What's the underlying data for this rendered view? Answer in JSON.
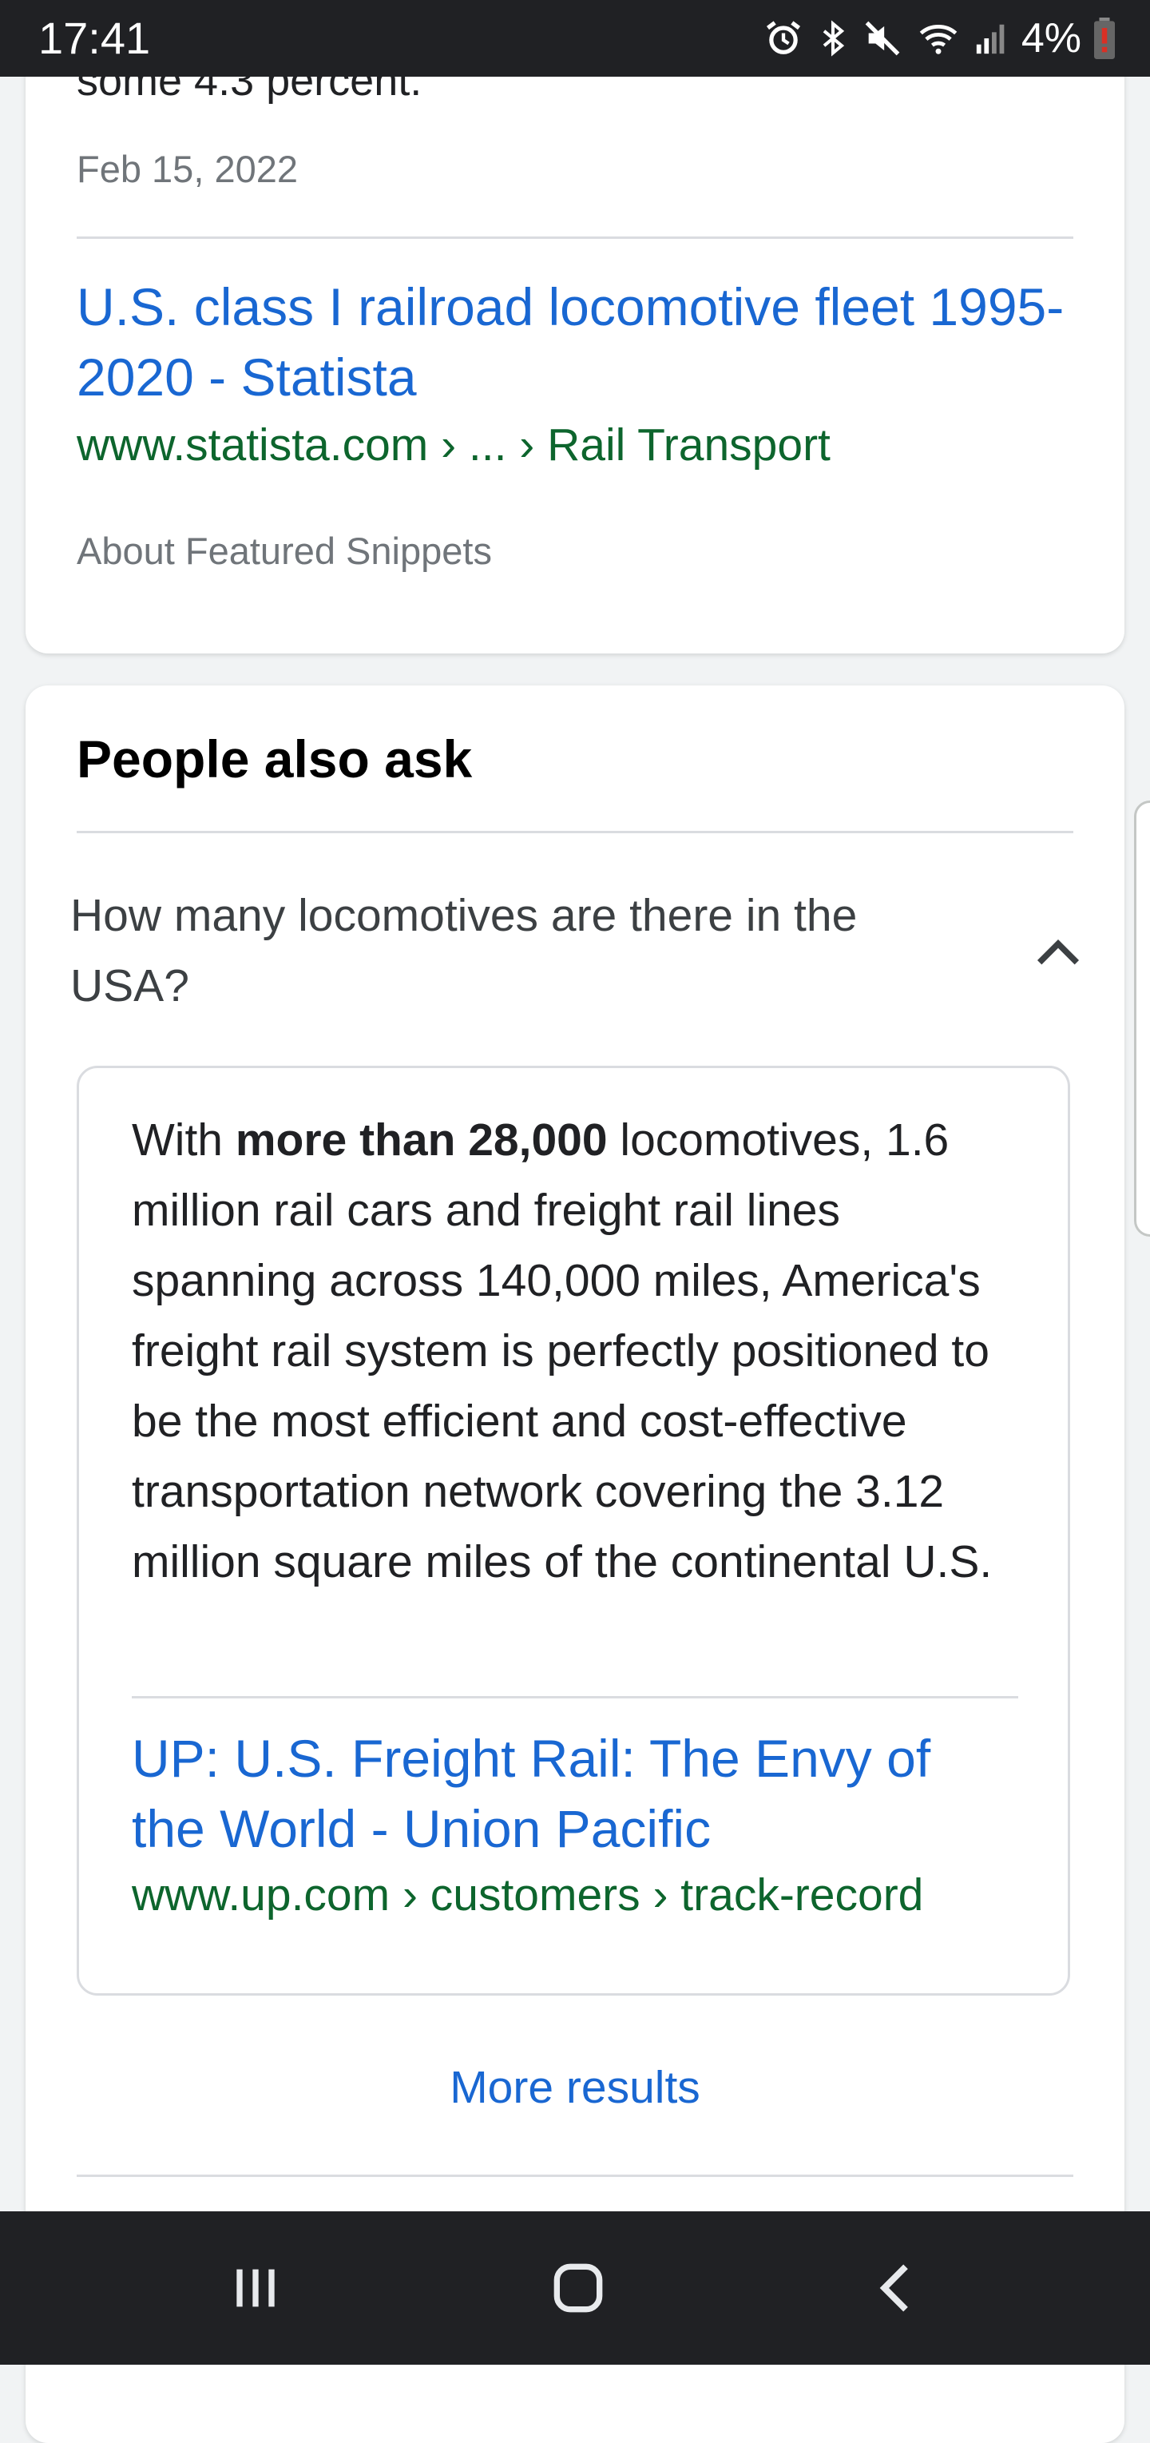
{
  "status_bar": {
    "time": "17:41",
    "battery": "4%",
    "icons": [
      "alarm-icon",
      "bluetooth-icon",
      "mute-icon",
      "wifi-icon",
      "signal-icon",
      "battery-low-icon"
    ]
  },
  "snippet": {
    "text_tail": "some 4.3 percent.",
    "date": "Feb 15, 2022",
    "source_title": "U.S. class I railroad locomotive fleet 1995-2020 - Statista",
    "source_url": "www.statista.com › ... › Rail Transport",
    "about": "About Featured Snippets"
  },
  "people_also_ask": {
    "title": "People also ask",
    "question": "How many locomotives are there in the USA?",
    "answer": {
      "lead": "With ",
      "bold": "more than 28,000",
      "rest": " locomotives, 1.6 million rail cars and freight rail lines spanning across 140,000 miles, America's freight rail system is perfectly positioned to be the most efficient and cost-effective transportation network covering the 3.12 million square miles of the continental U.S."
    },
    "source_title": "UP: U.S. Freight Rail: The Envy of the World - Union Pacific",
    "source_url": "www.up.com › customers › track-record",
    "more_results": "More results"
  },
  "nav_bar": {
    "buttons": [
      "recent-apps-icon",
      "home-icon",
      "back-icon"
    ]
  },
  "colors": {
    "link": "#1967d2",
    "url_green": "#0d652d",
    "muted": "#70757a",
    "system_bar": "#202124"
  }
}
